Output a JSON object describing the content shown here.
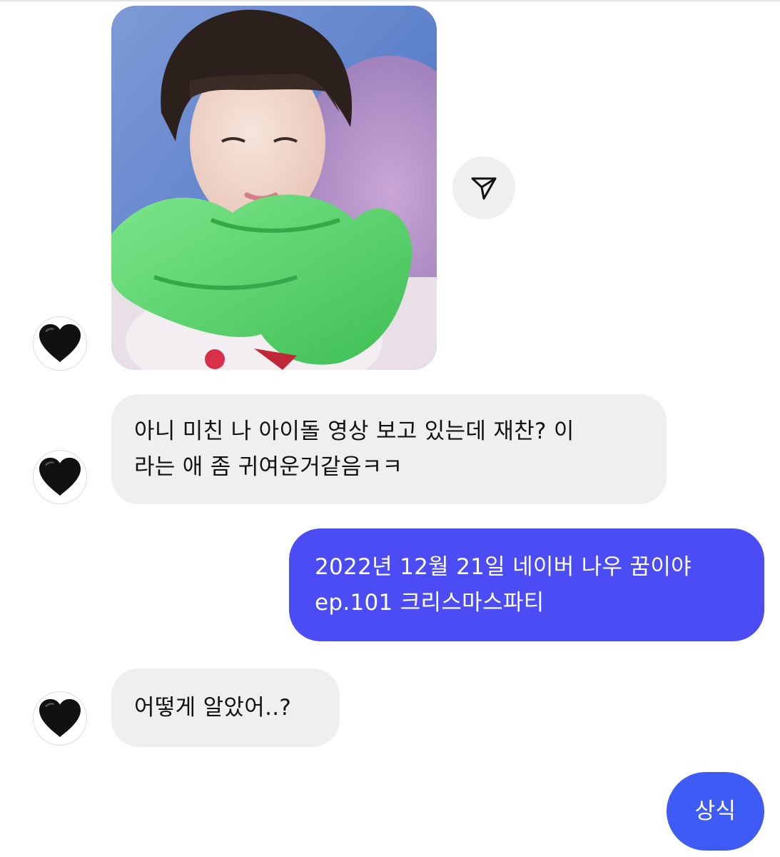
{
  "thread": {
    "messages": [
      {
        "sender": "other",
        "type": "image",
        "image_desc": "photo-attachment"
      },
      {
        "sender": "other",
        "type": "text",
        "lines": [
          "아니 미친 나 아이돌 영상 보고 있는데 재찬? 이",
          "라는 애 좀 귀여운거같음ㅋㅋ"
        ]
      },
      {
        "sender": "me",
        "type": "text",
        "lines": [
          "2022년 12월 21일 네이버 나우 꿈이야",
          "ep.101 크리스마스파티"
        ]
      },
      {
        "sender": "other",
        "type": "text",
        "lines": [
          "어떻게 알았어..?"
        ]
      },
      {
        "sender": "me",
        "type": "text",
        "lines": [
          "상식"
        ]
      }
    ]
  },
  "icons": {
    "avatar": "black-heart-icon",
    "share": "paper-plane-icon"
  },
  "colors": {
    "incoming_bubble": "#efefef",
    "outgoing_bubble_1": "#4b4cf4",
    "outgoing_bubble_2": "#3e5cf5",
    "share_button": "#efefef"
  }
}
